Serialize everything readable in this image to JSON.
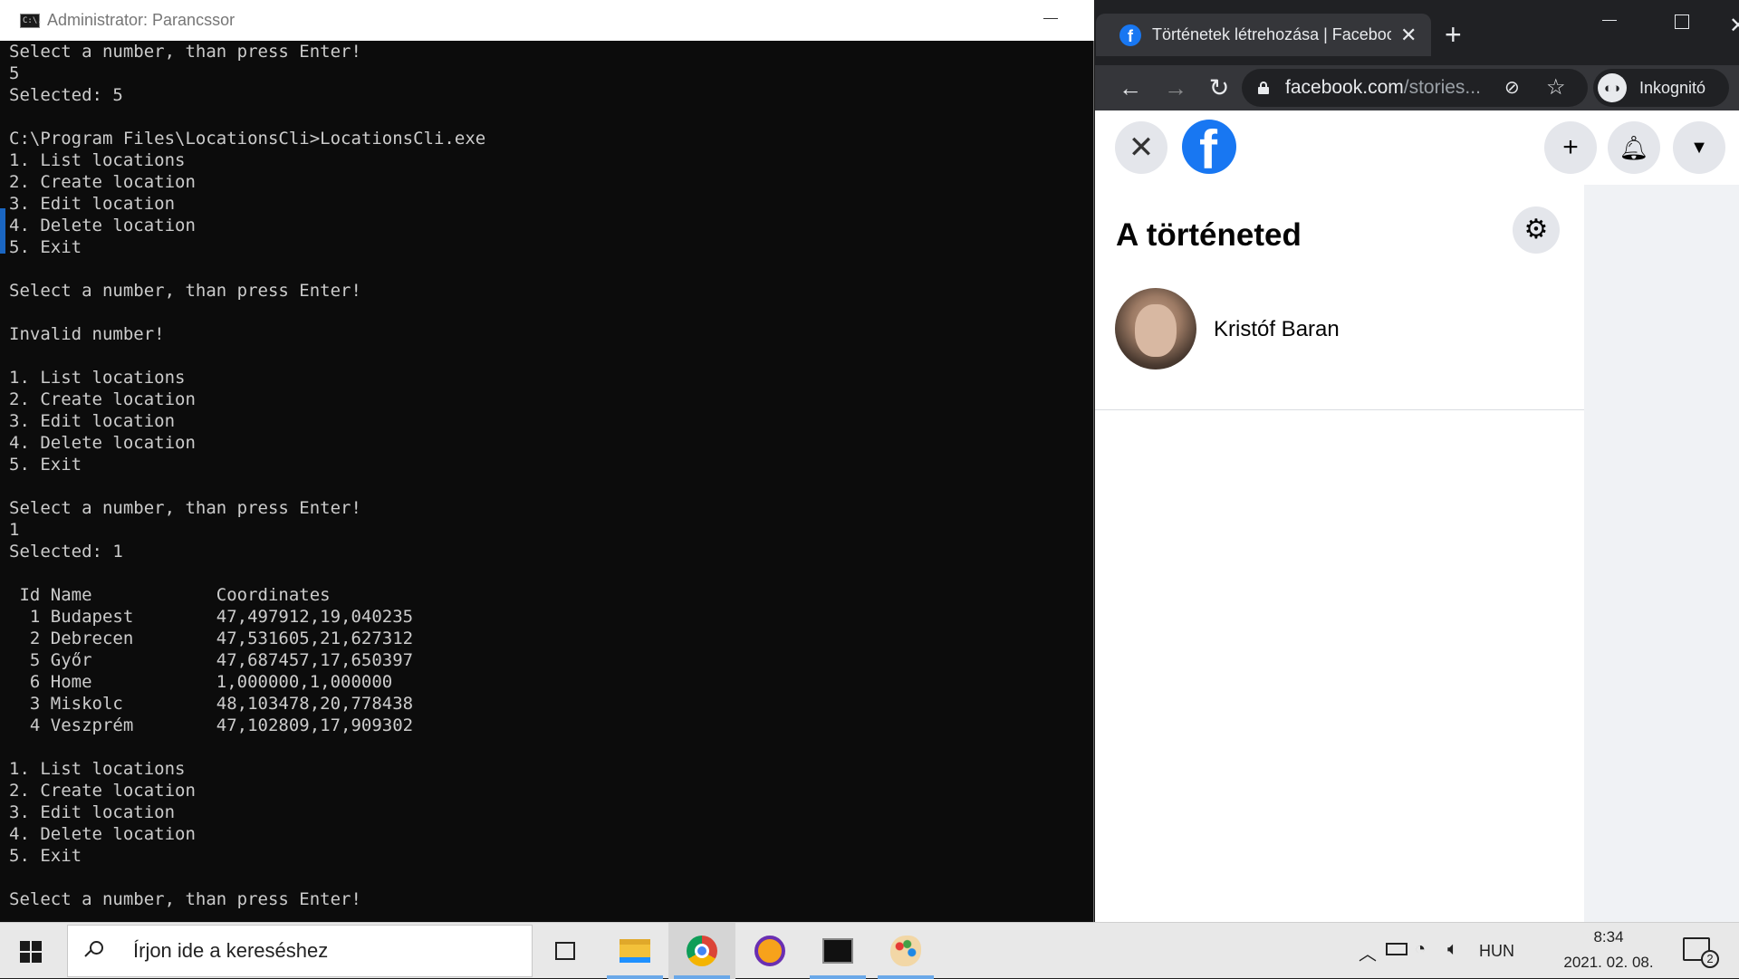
{
  "cmd": {
    "title": "Administrator: Parancssor",
    "icon": "cmd-icon",
    "icon_text": "C:\\.",
    "console_lines": [
      "Select a number, than press Enter!",
      "5",
      "Selected: 5",
      "",
      "C:\\Program Files\\LocationsCli>LocationsCli.exe",
      "1. List locations",
      "2. Create location",
      "3. Edit location",
      "4. Delete location",
      "5. Exit",
      "",
      "Select a number, than press Enter!",
      "",
      "Invalid number!",
      "",
      "1. List locations",
      "2. Create location",
      "3. Edit location",
      "4. Delete location",
      "5. Exit",
      "",
      "Select a number, than press Enter!",
      "1",
      "Selected: 1",
      "",
      " Id Name            Coordinates",
      "  1 Budapest        47,497912,19,040235",
      "  2 Debrecen        47,531605,21,627312",
      "  5 Győr            47,687457,17,650397",
      "  6 Home            1,000000,1,000000",
      "  3 Miskolc         48,103478,20,778438",
      "  4 Veszprém        47,102809,17,909302",
      "",
      "1. List locations",
      "2. Create location",
      "3. Edit location",
      "4. Delete location",
      "5. Exit",
      "",
      "Select a number, than press Enter!"
    ]
  },
  "browser": {
    "tab_title": "Történetek létrehozása | Facebook",
    "tab_favicon": "facebook-favicon",
    "url_host": "facebook.com",
    "url_rest": "/stories...",
    "incognito_label": "Inkognitó",
    "colors": {
      "tabstrip": "#202124",
      "toolbar": "#35363a",
      "text": "#e8eaed"
    }
  },
  "facebook": {
    "logo_letter": "f",
    "heading": "A történeted",
    "user_name": "Kristóf Baran",
    "brand_color": "#1877f2"
  },
  "taskbar": {
    "search_placeholder": "Írjon ide a kereséshez",
    "apps": [
      "task-view",
      "file-explorer",
      "chrome",
      "vpn",
      "command-prompt",
      "paint"
    ],
    "language": "HUN",
    "time": "8:34",
    "date": "2021. 02. 08.",
    "notification_count": "2"
  }
}
